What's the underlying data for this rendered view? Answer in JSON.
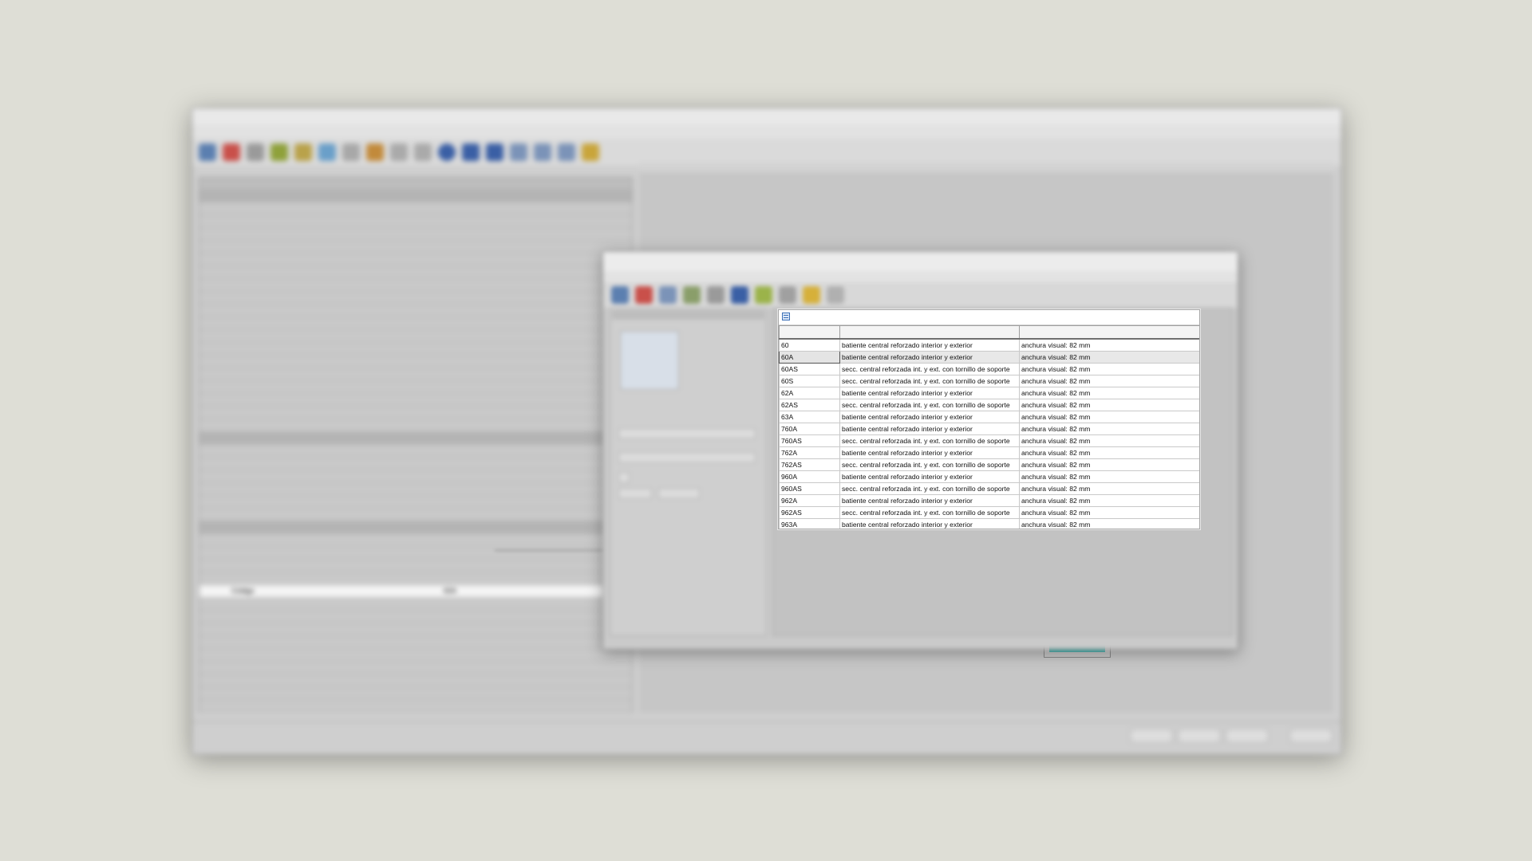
{
  "background_app": {
    "title": "",
    "menu": [],
    "left_selected_row": {
      "label": "Código",
      "value": "60A"
    }
  },
  "lookup_dialog": {
    "title": ""
  },
  "results_grid": {
    "columns": [
      "",
      "",
      ""
    ],
    "selected_index": 1,
    "rows": [
      {
        "code": "60",
        "description": "batiente central reforzado interior y exterior",
        "detail": "anchura visual: 82 mm"
      },
      {
        "code": "60A",
        "description": "batiente central reforzado interior y exterior",
        "detail": "anchura visual: 82 mm"
      },
      {
        "code": "60AS",
        "description": "secc. central reforzada int. y ext. con tornillo de soporte",
        "detail": "anchura visual: 82 mm"
      },
      {
        "code": "60S",
        "description": "secc. central reforzada int. y ext. con tornillo de soporte",
        "detail": "anchura visual: 82 mm"
      },
      {
        "code": "62A",
        "description": "batiente central reforzado interior y exterior",
        "detail": "anchura visual: 82 mm"
      },
      {
        "code": "62AS",
        "description": "secc. central reforzada int. y ext. con tornillo de soporte",
        "detail": "anchura visual: 82 mm"
      },
      {
        "code": "63A",
        "description": "batiente central reforzado interior y exterior",
        "detail": "anchura visual: 82 mm"
      },
      {
        "code": "760A",
        "description": "batiente central reforzado interior y exterior",
        "detail": "anchura visual: 82 mm"
      },
      {
        "code": "760AS",
        "description": "secc. central reforzada int. y ext. con tornillo de soporte",
        "detail": "anchura visual: 82 mm"
      },
      {
        "code": "762A",
        "description": "batiente central reforzado interior y exterior",
        "detail": "anchura visual: 82 mm"
      },
      {
        "code": "762AS",
        "description": "secc. central reforzada int. y ext. con tornillo de soporte",
        "detail": "anchura visual: 82 mm"
      },
      {
        "code": "960A",
        "description": "batiente central reforzado interior y exterior",
        "detail": "anchura visual: 82 mm"
      },
      {
        "code": "960AS",
        "description": "secc. central reforzada int. y ext. con tornillo de soporte",
        "detail": "anchura visual: 82 mm"
      },
      {
        "code": "962A",
        "description": "batiente central reforzado interior y exterior",
        "detail": "anchura visual: 82 mm"
      },
      {
        "code": "962AS",
        "description": "secc. central reforzada int. y ext. con tornillo de soporte",
        "detail": "anchura visual: 82 mm"
      },
      {
        "code": "963A",
        "description": "batiente central reforzado interior y exterior",
        "detail": "anchura visual: 82 mm"
      }
    ]
  },
  "colors": {
    "triangle_marker": "#c81d1d",
    "window_glass": "#37a8a5"
  }
}
